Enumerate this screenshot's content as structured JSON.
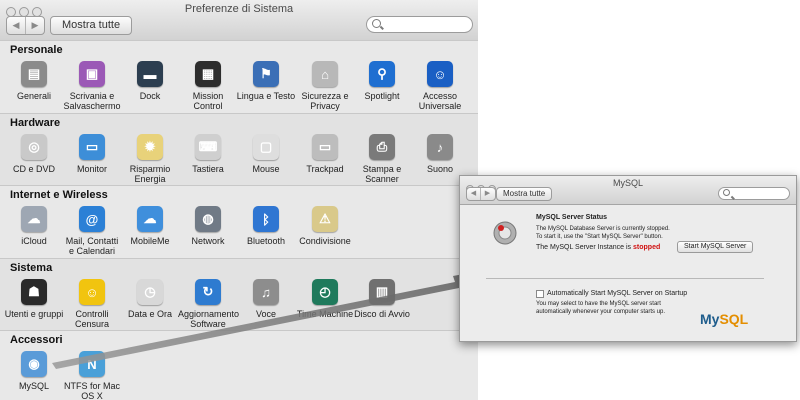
{
  "main_window": {
    "title": "Preferenze di Sistema",
    "show_all": "Mostra tutte",
    "back_glyph": "◀",
    "forward_glyph": "▶",
    "search_placeholder": "",
    "sections": [
      {
        "title": "Personale",
        "items": [
          {
            "label": "Generali",
            "icon": "general-icon",
            "color": "#8b8b8b",
            "glyph": "▤"
          },
          {
            "label": "Scrivania e Salvaschermo",
            "icon": "desktop-screensaver-icon",
            "color": "#9b59b6",
            "glyph": "▣"
          },
          {
            "label": "Dock",
            "icon": "dock-icon",
            "color": "#2c3e50",
            "glyph": "▬"
          },
          {
            "label": "Mission Control",
            "icon": "mission-control-icon",
            "color": "#2d2d2d",
            "glyph": "▦"
          },
          {
            "label": "Lingua e Testo",
            "icon": "language-text-icon",
            "color": "#3b6fb6",
            "glyph": "⚑"
          },
          {
            "label": "Sicurezza e Privacy",
            "icon": "security-privacy-icon",
            "color": "#b8b8b8",
            "glyph": "⌂"
          },
          {
            "label": "Spotlight",
            "icon": "spotlight-icon",
            "color": "#1f6fd1",
            "glyph": "⚲"
          },
          {
            "label": "Accesso Universale",
            "icon": "universal-access-icon",
            "color": "#1a5fc4",
            "glyph": "☺"
          }
        ]
      },
      {
        "title": "Hardware",
        "items": [
          {
            "label": "CD e DVD",
            "icon": "cd-dvd-icon",
            "color": "#c9c9c9",
            "glyph": "◎"
          },
          {
            "label": "Monitor",
            "icon": "monitor-icon",
            "color": "#3d8ed8",
            "glyph": "▭"
          },
          {
            "label": "Risparmio Energia",
            "icon": "energy-saver-icon",
            "color": "#e8d27a",
            "glyph": "✹"
          },
          {
            "label": "Tastiera",
            "icon": "keyboard-icon",
            "color": "#cfcfcf",
            "glyph": "⌨"
          },
          {
            "label": "Mouse",
            "icon": "mouse-icon",
            "color": "#dedede",
            "glyph": "▢"
          },
          {
            "label": "Trackpad",
            "icon": "trackpad-icon",
            "color": "#bdbdbd",
            "glyph": "▭"
          },
          {
            "label": "Stampa e Scanner",
            "icon": "printer-scanner-icon",
            "color": "#7a7a7a",
            "glyph": "⎙"
          },
          {
            "label": "Suono",
            "icon": "sound-icon",
            "color": "#8a8a8a",
            "glyph": "♪"
          }
        ]
      },
      {
        "title": "Internet e Wireless",
        "items": [
          {
            "label": "iCloud",
            "icon": "icloud-icon",
            "color": "#9ea7b3",
            "glyph": "☁"
          },
          {
            "label": "Mail, Contatti e Calendari",
            "icon": "mail-contacts-calendars-icon",
            "color": "#2b80d6",
            "glyph": "@"
          },
          {
            "label": "MobileMe",
            "icon": "mobileme-icon",
            "color": "#3f8fdc",
            "glyph": "☁"
          },
          {
            "label": "Network",
            "icon": "network-icon",
            "color": "#707a86",
            "glyph": "◍"
          },
          {
            "label": "Bluetooth",
            "icon": "bluetooth-icon",
            "color": "#2f76d2",
            "glyph": "ᛒ"
          },
          {
            "label": "Condivisione",
            "icon": "sharing-icon",
            "color": "#d9c98a",
            "glyph": "⚠"
          }
        ]
      },
      {
        "title": "Sistema",
        "items": [
          {
            "label": "Utenti e gruppi",
            "icon": "users-groups-icon",
            "color": "#2a2a2a",
            "glyph": "☗"
          },
          {
            "label": "Controlli Censura",
            "icon": "parental-controls-icon",
            "color": "#f1c40f",
            "glyph": "☺"
          },
          {
            "label": "Data e Ora",
            "icon": "date-time-icon",
            "color": "#d8d8d8",
            "glyph": "◷"
          },
          {
            "label": "Aggiornamento Software",
            "icon": "software-update-icon",
            "color": "#2e7bd0",
            "glyph": "↻"
          },
          {
            "label": "Voce",
            "icon": "speech-icon",
            "color": "#8d8d8d",
            "glyph": "♫"
          },
          {
            "label": "Time Machine",
            "icon": "time-machine-icon",
            "color": "#1f7a5c",
            "glyph": "◴"
          },
          {
            "label": "Disco di Avvio",
            "icon": "startup-disk-icon",
            "color": "#707070",
            "glyph": "▥"
          }
        ]
      },
      {
        "title": "Accessori",
        "items": [
          {
            "label": "MySQL",
            "icon": "mysql-icon",
            "color": "#5a9bd8",
            "glyph": "◉"
          },
          {
            "label": "NTFS for Mac OS X",
            "icon": "ntfs-icon",
            "color": "#4aa0d8",
            "glyph": "N"
          }
        ]
      }
    ]
  },
  "mysql_window": {
    "title": "MySQL",
    "show_all": "Mostra tutte",
    "back_glyph": "◀",
    "forward_glyph": "▶",
    "status_heading": "MySQL Server Status",
    "status_line1": "The MySQL Database Server is currently stopped.",
    "status_line2": "To start it, use the \"Start MySQL Server\" button.",
    "instance_text": "The MySQL Server Instance is",
    "instance_state": "stopped",
    "start_button": "Start MySQL Server",
    "auto_start_label": "Automatically Start MySQL Server on Startup",
    "auto_start_desc1": "You may select to have the MySQL server start",
    "auto_start_desc2": "automatically whenever your computer starts up.",
    "logo_my": "My",
    "logo_sql": "SQL",
    "auto_start_checked": false
  }
}
